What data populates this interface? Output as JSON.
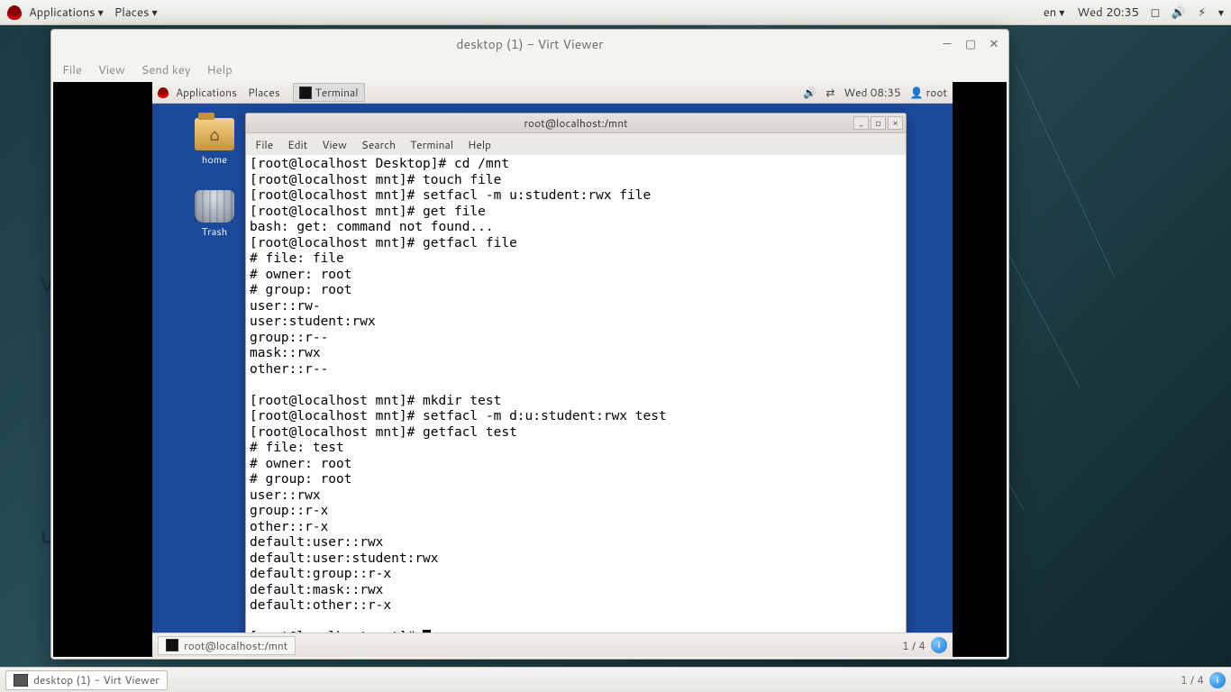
{
  "host": {
    "applications_label": "Applications",
    "places_label": "Places",
    "lang": "en",
    "clock": "Wed  20:35"
  },
  "virtviewer": {
    "title": "desktop (1) - Virt Viewer",
    "menu": {
      "file": "File",
      "view": "View",
      "sendkey": "Send key",
      "help": "Help"
    }
  },
  "guest_panel": {
    "applications_label": "Applications",
    "places_label": "Places",
    "terminal_tab": "Terminal",
    "clock": "Wed 08:35",
    "user": "root",
    "home_label": "home",
    "trash_label": "Trash"
  },
  "terminal": {
    "title": "root@localhost:/mnt",
    "menu": {
      "file": "File",
      "edit": "Edit",
      "view": "View",
      "search": "Search",
      "terminal": "Terminal",
      "help": "Help"
    },
    "content": "[root@localhost Desktop]# cd /mnt\n[root@localhost mnt]# touch file\n[root@localhost mnt]# setfacl -m u:student:rwx file\n[root@localhost mnt]# get file\nbash: get: command not found...\n[root@localhost mnt]# getfacl file\n# file: file\n# owner: root\n# group: root\nuser::rw-\nuser:student:rwx\ngroup::r--\nmask::rwx\nother::r--\n\n[root@localhost mnt]# mkdir test\n[root@localhost mnt]# setfacl -m d:u:student:rwx test\n[root@localhost mnt]# getfacl test\n# file: test\n# owner: root\n# group: root\nuser::rwx\ngroup::r-x\nother::r-x\ndefault:user::rwx\ndefault:user:student:rwx\ndefault:group::r-x\ndefault:mask::rwx\ndefault:other::r-x\n\n[root@localhost mnt]# "
  },
  "guest_bottom": {
    "task_label": "root@localhost:/mnt",
    "workspace": "1 / 4"
  },
  "host_bottom": {
    "task_label": "desktop (1) - Virt Viewer",
    "workspace": "1 / 4"
  },
  "bg_letters": {
    "a": "V",
    "b": "U"
  }
}
